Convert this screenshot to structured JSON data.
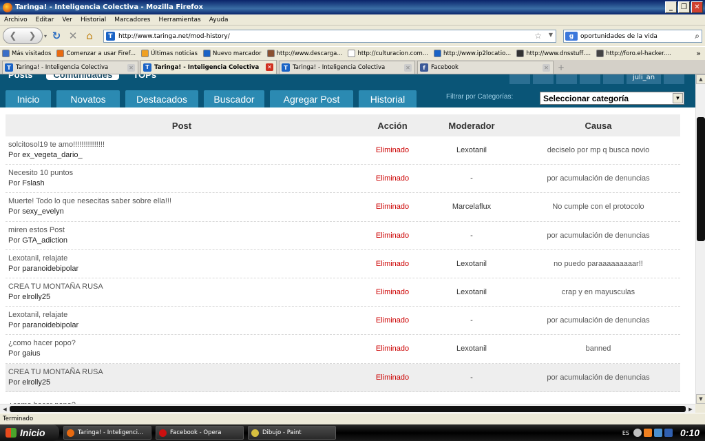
{
  "window": {
    "title": "Taringa! - Inteligencia Colectiva - Mozilla Firefox"
  },
  "menu": [
    "Archivo",
    "Editar",
    "Ver",
    "Historial",
    "Marcadores",
    "Herramientas",
    "Ayuda"
  ],
  "nav": {
    "url": "http://www.taringa.net/mod-history/",
    "search_value": "oportunidades de la vida"
  },
  "bookmarks": [
    {
      "label": "Más visitados",
      "color": "#3b6fc7"
    },
    {
      "label": "Comenzar a usar Firef...",
      "color": "#e86a10"
    },
    {
      "label": "Últimas noticias",
      "color": "#f0a020"
    },
    {
      "label": "Nuevo marcador",
      "color": "#1a63c6"
    },
    {
      "label": "http://www.descarga...",
      "color": "#8a5030"
    },
    {
      "label": "http://culturacion.com...",
      "color": "#ffffff"
    },
    {
      "label": "http://www.ip2locatio...",
      "color": "#1a63c6"
    },
    {
      "label": "http://www.dnsstuff....",
      "color": "#333333"
    },
    {
      "label": "http://foro.el-hacker....",
      "color": "#444444"
    }
  ],
  "tabs": [
    {
      "label": "Taringa! - Inteligencia Colectiva",
      "active": false
    },
    {
      "label": "Taringa! - Inteligencia Colectiva",
      "active": true
    },
    {
      "label": "Taringa! - Inteligencia Colectiva",
      "active": false
    },
    {
      "label": "Facebook",
      "active": false
    }
  ],
  "site": {
    "top_nav": [
      "Posts",
      "Comunidades",
      "TOPs"
    ],
    "user": "juli_an",
    "nav": [
      "Inicio",
      "Novatos",
      "Destacados",
      "Buscador",
      "Agregar Post",
      "Historial"
    ],
    "filter_label": "Filtrar por Categorías:",
    "category_selected": "Seleccionar categoría"
  },
  "table": {
    "headers": {
      "post": "Post",
      "accion": "Acción",
      "moderador": "Moderador",
      "causa": "Causa"
    },
    "rows": [
      {
        "title": "solcitosol19 te amo!!!!!!!!!!!!!!!",
        "by_prefix": "Por",
        "author": "ex_vegeta_dario_",
        "accion": "Eliminado",
        "moderador": "Lexotanil",
        "causa": "deciselo por mp q busca novio"
      },
      {
        "title": "Necesito 10 puntos",
        "by_prefix": "Por",
        "author": "Fslash",
        "accion": "Eliminado",
        "moderador": "-",
        "causa": "por acumulación de denuncias"
      },
      {
        "title": "Muerte! Todo lo que nesecitas saber sobre ella!!!",
        "by_prefix": "Por",
        "author": "sexy_evelyn",
        "accion": "Eliminado",
        "moderador": "Marcelaflux",
        "causa": "No cumple con el protocolo"
      },
      {
        "title": "miren estos Post",
        "by_prefix": "Por",
        "author": "GTA_adiction",
        "accion": "Eliminado",
        "moderador": "-",
        "causa": "por acumulación de denuncias"
      },
      {
        "title": "Lexotanil, relajate",
        "by_prefix": "Por",
        "author": "paranoidebipolar",
        "accion": "Eliminado",
        "moderador": "Lexotanil",
        "causa": "no puedo paraaaaaaaaar!!"
      },
      {
        "title": "CREA TU MONTAÑA RUSA",
        "by_prefix": "Por",
        "author": "elrolly25",
        "accion": "Eliminado",
        "moderador": "Lexotanil",
        "causa": "crap y en mayusculas"
      },
      {
        "title": "Lexotanil, relajate",
        "by_prefix": "Por",
        "author": "paranoidebipolar",
        "accion": "Eliminado",
        "moderador": "-",
        "causa": "por acumulación de denuncias"
      },
      {
        "title": "¿como hacer popo?",
        "by_prefix": "Por",
        "author": "gaius",
        "accion": "Eliminado",
        "moderador": "Lexotanil",
        "causa": "banned"
      },
      {
        "title": "CREA TU MONTAÑA RUSA",
        "by_prefix": "Por",
        "author": "elrolly25",
        "accion": "Eliminado",
        "moderador": "-",
        "causa": "por acumulación de denuncias"
      },
      {
        "title": "¿como hacer popo?",
        "by_prefix": "",
        "author": "",
        "accion": "",
        "moderador": "",
        "causa": ""
      }
    ]
  },
  "status": "Terminado",
  "taskbar": {
    "start": "Inicio",
    "tasks": [
      {
        "label": "Taringa! - Inteligenci...",
        "color": "#e86a10"
      },
      {
        "label": "Facebook - Opera",
        "color": "#cc1010"
      },
      {
        "label": "Dibujo - Paint",
        "color": "#d8c040"
      }
    ],
    "lang": "ES",
    "clock": "0:10"
  }
}
